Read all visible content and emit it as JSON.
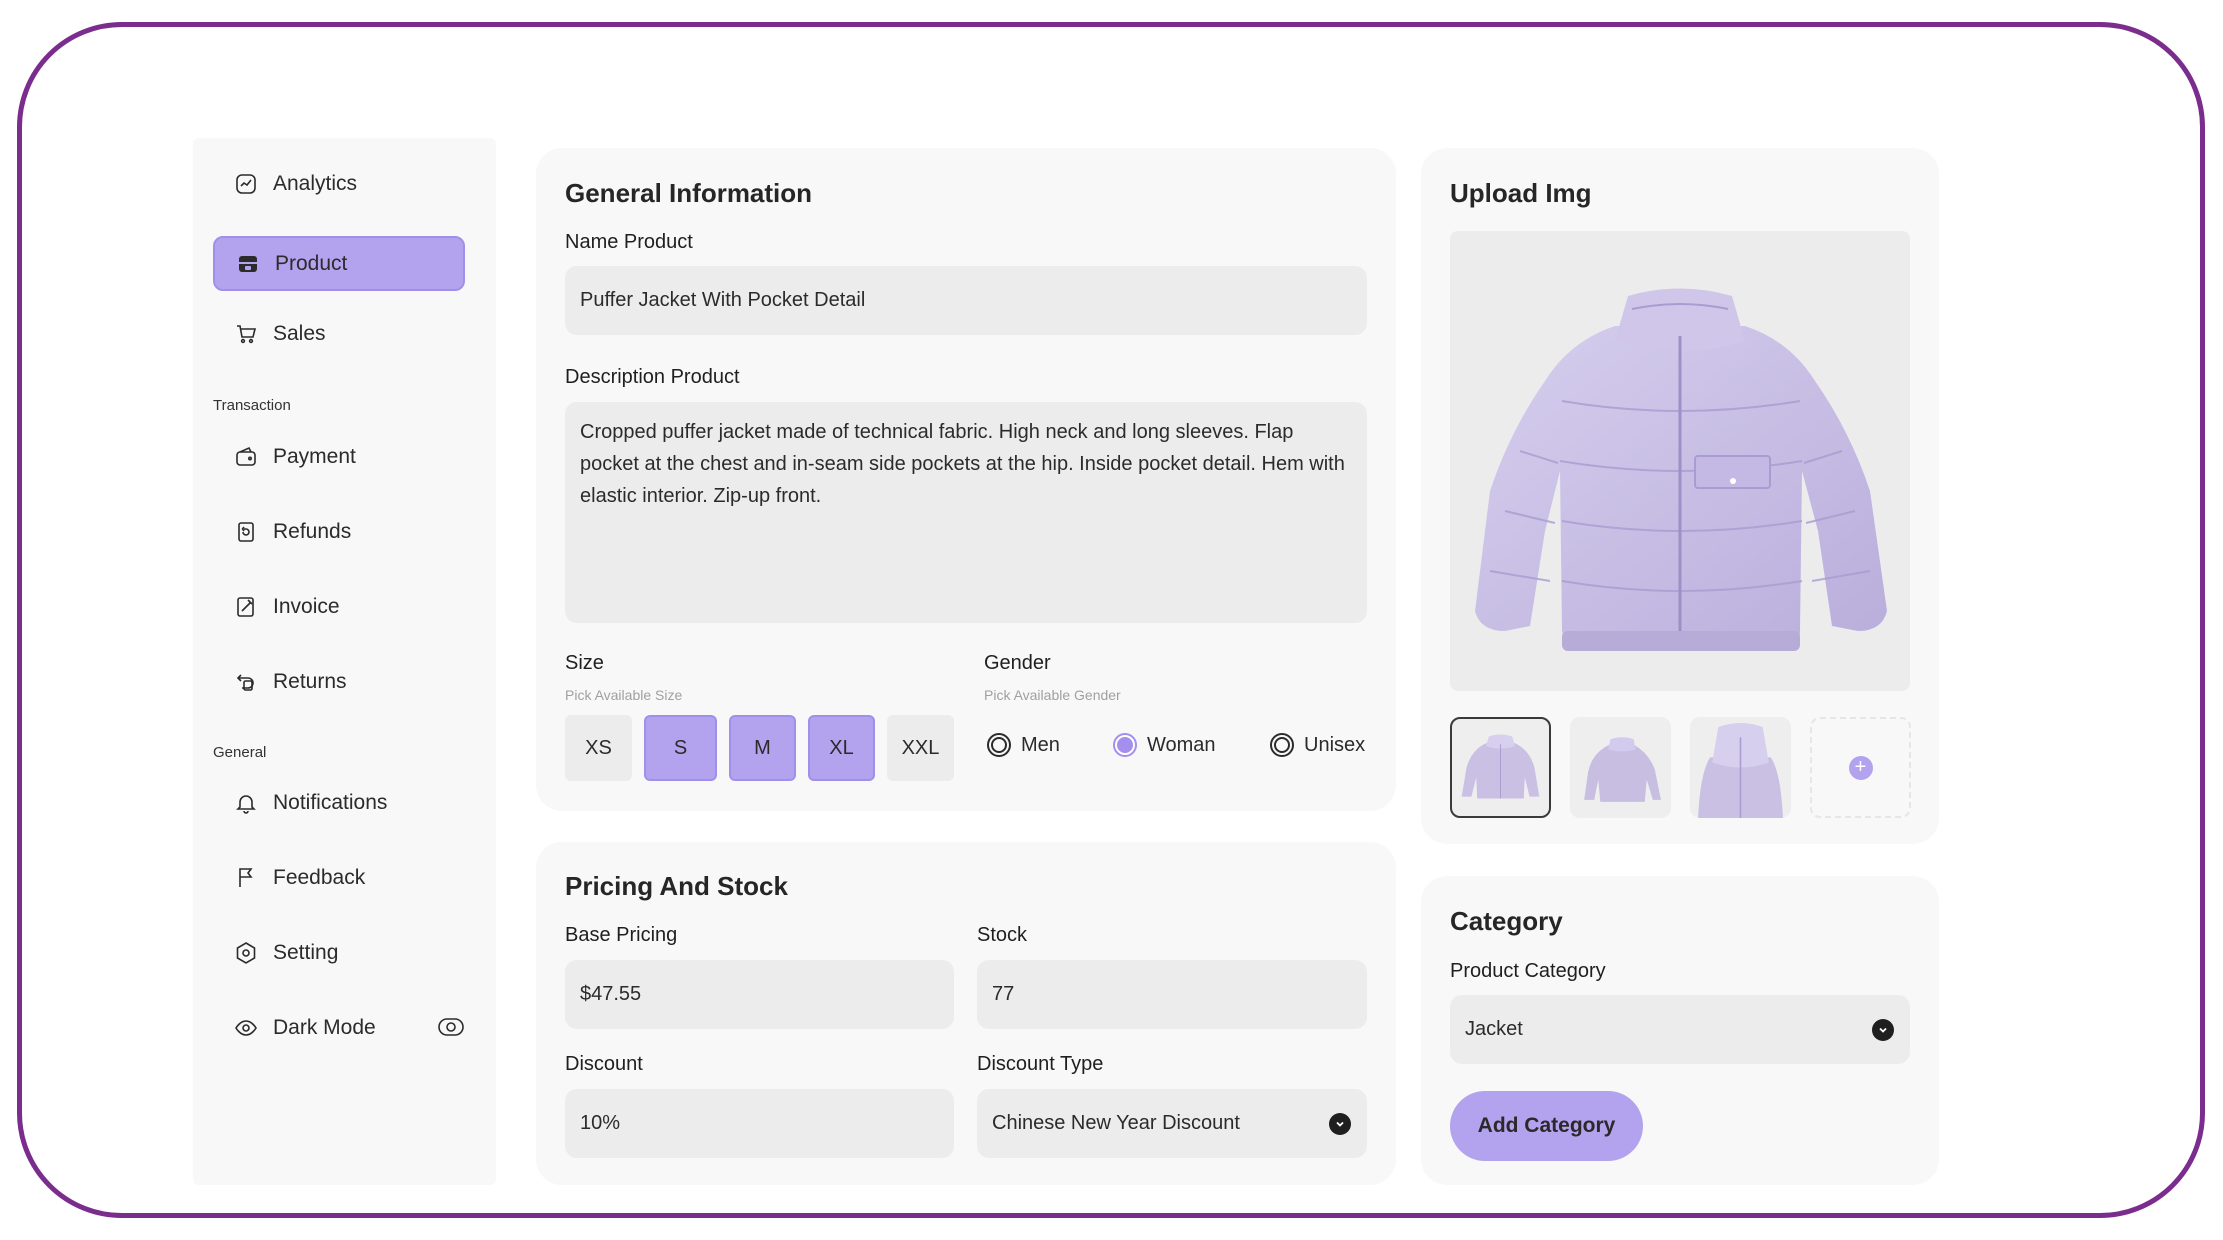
{
  "sidebar": {
    "items_top": [
      {
        "label": "Analytics",
        "icon": "analytics-icon"
      },
      {
        "label": "Product",
        "icon": "product-icon",
        "active": true
      },
      {
        "label": "Sales",
        "icon": "cart-icon"
      }
    ],
    "section_transaction": "Transaction",
    "items_transaction": [
      {
        "label": "Payment",
        "icon": "wallet-icon"
      },
      {
        "label": "Refunds",
        "icon": "refund-icon"
      },
      {
        "label": "Invoice",
        "icon": "invoice-icon"
      },
      {
        "label": "Returns",
        "icon": "returns-icon"
      }
    ],
    "section_general": "General",
    "items_general": [
      {
        "label": "Notifications",
        "icon": "bell-icon"
      },
      {
        "label": "Feedback",
        "icon": "flag-icon"
      },
      {
        "label": "Setting",
        "icon": "gear-icon"
      },
      {
        "label": "Dark Mode",
        "icon": "eye-icon"
      }
    ]
  },
  "general_info": {
    "title": "General Information",
    "name_label": "Name Product",
    "name_value": "Puffer Jacket With Pocket Detail",
    "desc_label": "Description Product",
    "desc_value": "Cropped puffer jacket made of technical fabric. High neck and long sleeves. Flap pocket at the chest and in-seam side pockets at the hip. Inside pocket detail. Hem with elastic interior. Zip-up front.",
    "size_label": "Size",
    "size_hint": "Pick Available Size",
    "sizes": [
      {
        "label": "XS",
        "selected": false
      },
      {
        "label": "S",
        "selected": true
      },
      {
        "label": "M",
        "selected": true
      },
      {
        "label": "XL",
        "selected": true
      },
      {
        "label": "XXL",
        "selected": false
      }
    ],
    "gender_label": "Gender",
    "gender_hint": "Pick Available Gender",
    "genders": [
      {
        "label": "Men",
        "checked": false
      },
      {
        "label": "Woman",
        "checked": true
      },
      {
        "label": "Unisex",
        "checked": false
      }
    ]
  },
  "pricing": {
    "title": "Pricing And Stock",
    "base_label": "Base Pricing",
    "base_value": "$47.55",
    "stock_label": "Stock",
    "stock_value": "77",
    "discount_label": "Discount",
    "discount_value": "10%",
    "discount_type_label": "Discount Type",
    "discount_type_value": "Chinese New Year Discount"
  },
  "upload": {
    "title": "Upload Img",
    "main_image": "jacket-image",
    "thumbnails": [
      "jacket-front-thumbnail",
      "jacket-angle-thumbnail",
      "jacket-collar-thumbnail"
    ],
    "add_icon": "plus-icon"
  },
  "category": {
    "title": "Category",
    "label": "Product Category",
    "value": "Jacket",
    "button": "Add Category"
  },
  "colors": {
    "accent": "#b3a3ee",
    "frame_border": "#7b2d8e",
    "jacket": "#c9c0e3"
  }
}
